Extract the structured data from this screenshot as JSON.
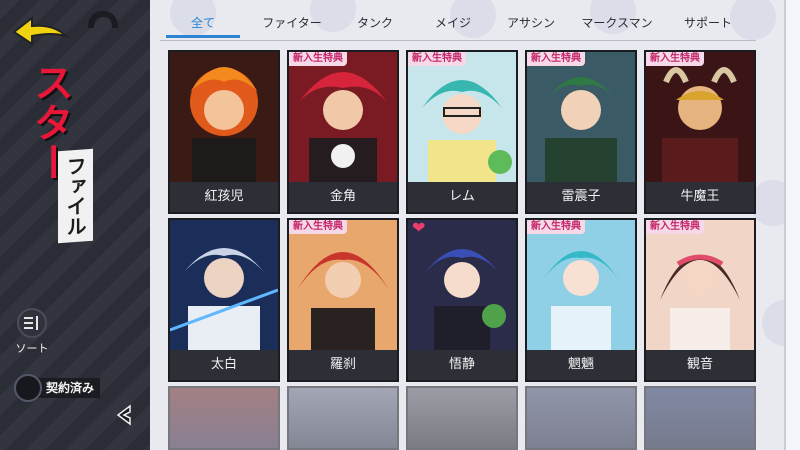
{
  "header": {
    "back_icon": "back-arrow-icon",
    "curl_icon": "curl-icon"
  },
  "sidebar": {
    "title_main": "スター",
    "title_sub": "ファイル",
    "sort_icon": "sort-icon",
    "sort_label": "ソート",
    "contract_label": "契約済み",
    "collapse_icon": "collapse-arrow-icon"
  },
  "tabs": [
    {
      "label": "全て",
      "active": true
    },
    {
      "label": "ファイター",
      "active": false
    },
    {
      "label": "タンク",
      "active": false
    },
    {
      "label": "メイジ",
      "active": false
    },
    {
      "label": "アサシン",
      "active": false
    },
    {
      "label": "マークスマン",
      "active": false
    },
    {
      "label": "サポート",
      "active": false
    }
  ],
  "badge_text": "新入生特典",
  "colors": {
    "accent": "#2d83d4",
    "title_red": "#e8173a",
    "panel_dark": "#2b2d36"
  },
  "cards": [
    {
      "name": "紅孩児",
      "badge": false,
      "art": "fire"
    },
    {
      "name": "金角",
      "badge": true,
      "art": "red"
    },
    {
      "name": "レム",
      "badge": true,
      "art": "teal"
    },
    {
      "name": "雷震子",
      "badge": true,
      "art": "green"
    },
    {
      "name": "牛魔王",
      "badge": true,
      "art": "gold"
    },
    {
      "name": "太白",
      "badge": false,
      "art": "blue"
    },
    {
      "name": "羅刹",
      "badge": true,
      "art": "crimson"
    },
    {
      "name": "悟静",
      "badge": false,
      "heart": true,
      "art": "navy"
    },
    {
      "name": "魍魎",
      "badge": true,
      "art": "cyan"
    },
    {
      "name": "観音",
      "badge": true,
      "art": "pink"
    }
  ]
}
